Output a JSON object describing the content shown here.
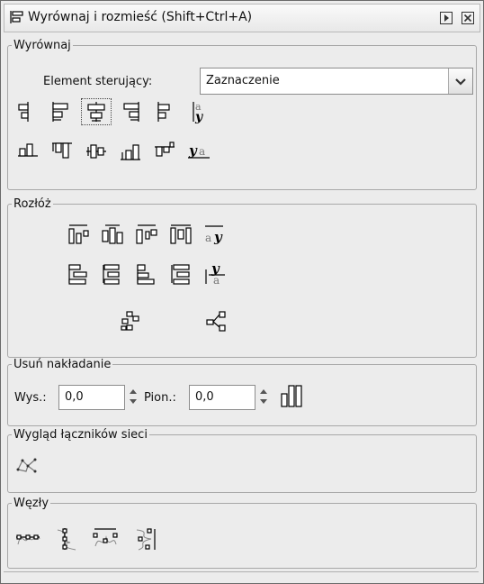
{
  "window": {
    "title": "Wyrównaj i rozmieść (Shift+Ctrl+A)"
  },
  "align": {
    "section_label": "Wyrównaj",
    "relative_label": "Element sterujący:",
    "relative_value": "Zaznaczenie"
  },
  "distribute": {
    "section_label": "Rozłóż"
  },
  "overlap": {
    "section_label": "Usuń nakładanie",
    "h_label": "Wys.:",
    "h_value": "0,0",
    "v_label": "Pion.:",
    "v_value": "0,0"
  },
  "connectors": {
    "section_label": "Wygląd łączników sieci"
  },
  "nodes": {
    "section_label": "Węzły"
  }
}
